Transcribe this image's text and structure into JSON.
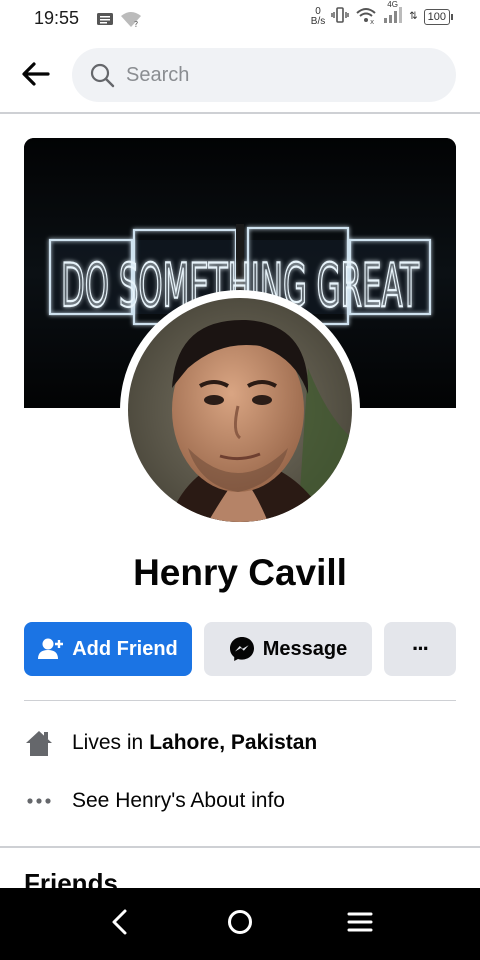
{
  "status_bar": {
    "time": "19:55",
    "net_speed_value": "0",
    "net_speed_unit": "B/s",
    "network_label": "4G",
    "battery": "100"
  },
  "search": {
    "placeholder": "Search"
  },
  "cover": {
    "sign_text": "DO SOMETHING GREAT"
  },
  "profile": {
    "name": "Henry Cavill"
  },
  "actions": {
    "add_friend": "Add Friend",
    "message": "Message",
    "more": "···"
  },
  "info": {
    "lives_prefix": "Lives in",
    "lives_location": "Lahore, Pakistan",
    "about": "See Henry's About info"
  },
  "friends": {
    "heading": "Friends"
  },
  "colors": {
    "primary": "#1b74e4",
    "secondary_button": "#e4e6eb",
    "search_bg": "#f0f2f5",
    "text": "#050505",
    "nav_bar": "#000000"
  },
  "icons": [
    "message-icon",
    "wifi-icon",
    "signal-icon",
    "vibrate-icon",
    "back-arrow-icon",
    "search-icon",
    "add-friend-icon",
    "messenger-icon",
    "more-icon",
    "home-icon",
    "dots-icon",
    "nav-back-icon",
    "nav-home-icon",
    "nav-menu-icon"
  ]
}
